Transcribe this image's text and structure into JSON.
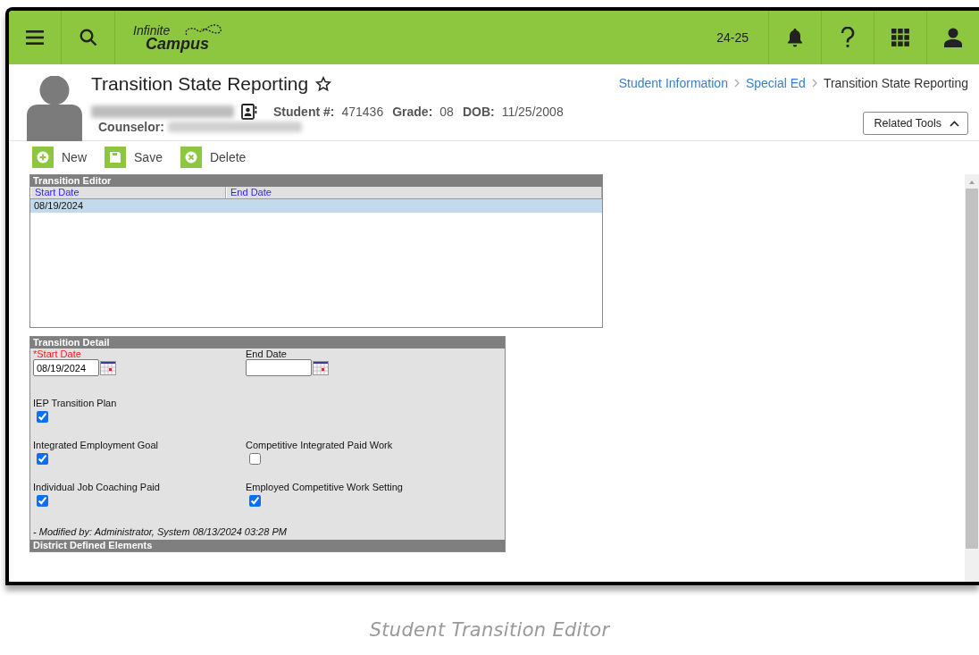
{
  "header": {
    "logo_top": "Infinite",
    "logo_bottom": "Campus",
    "school_year": "24-25"
  },
  "page": {
    "title": "Transition State Reporting",
    "breadcrumbs": [
      {
        "label": "Student Information",
        "current": false
      },
      {
        "label": "Special Ed",
        "current": false
      },
      {
        "label": "Transition State Reporting",
        "current": true
      }
    ],
    "student": {
      "id_label": "Student #:",
      "id": "471436",
      "grade_label": "Grade:",
      "grade": "08",
      "dob_label": "DOB:",
      "dob": "11/25/2008",
      "counselor_label": "Counselor:"
    },
    "related_tools": "Related Tools"
  },
  "toolbar": [
    {
      "label": "New",
      "kind": "add"
    },
    {
      "label": "Save",
      "kind": "save"
    },
    {
      "label": "Delete",
      "kind": "delete"
    }
  ],
  "editor": {
    "title": "Transition Editor",
    "columns": [
      "Start Date",
      "End Date"
    ],
    "rows": [
      {
        "start_date": "08/19/2024",
        "selected": true
      }
    ]
  },
  "detail": {
    "title": "Transition Detail",
    "date_fields": [
      {
        "label": "*Start Date",
        "required": true,
        "value": "08/19/2024"
      },
      {
        "label": "End Date",
        "required": false
      }
    ],
    "checkbox_rows": [
      {
        "items": [
          {
            "label": "IEP Transition Plan",
            "checked": true
          }
        ]
      },
      {
        "items": [
          {
            "label": "Integrated Employment Goal",
            "checked": true
          },
          {
            "label": "Competitive Integrated Paid Work",
            "checked": false
          }
        ]
      },
      {
        "items": [
          {
            "label": "Individual Job Coaching Paid",
            "checked": true
          },
          {
            "label": "Employed Competitive Work Setting",
            "checked": true
          }
        ]
      }
    ],
    "modified": "- Modified by: Administrator, System 08/13/2024 03:28 PM",
    "section": "District Defined Elements"
  },
  "caption": "Student Transition Editor"
}
